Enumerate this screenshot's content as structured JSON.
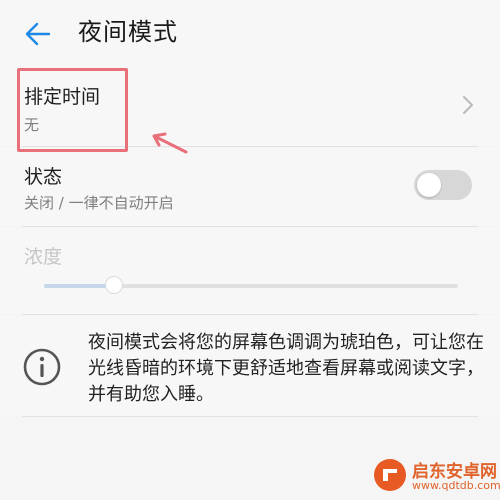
{
  "header": {
    "back_icon": "arrow-left-icon",
    "title": "夜间模式"
  },
  "settings": {
    "schedule": {
      "title": "排定时间",
      "value": "无",
      "chevron_icon": "chevron-right-icon"
    },
    "status": {
      "title": "状态",
      "value": "关闭 / 一律不自动开启",
      "toggle_on": false
    },
    "intensity": {
      "title": "浓度",
      "level": 0.17,
      "disabled": true
    }
  },
  "info": {
    "icon": "info-circle-icon",
    "text": "夜间模式会将您的屏幕色调调为琥珀色，可让您在光线昏暗的环境下更舒适地查看屏幕或阅读文字，并有助您入睡。"
  },
  "annotation": {
    "highlight_color": "#e8707a"
  },
  "watermark": {
    "name": "启东安卓网",
    "url": "www.qdtdb.com"
  },
  "colors": {
    "accent": "#1e88e5",
    "background": "#f7f7f7",
    "divider": "#e2e2e2",
    "toggle_off": "#d7d7d7"
  }
}
